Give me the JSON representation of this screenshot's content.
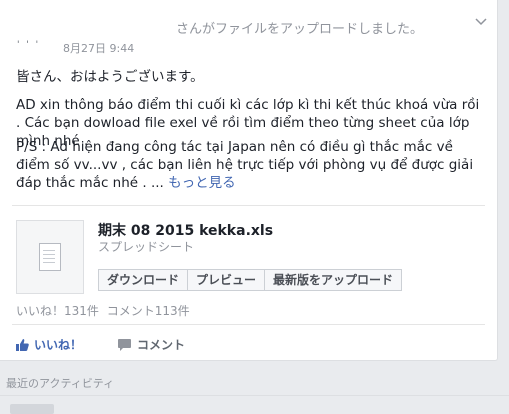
{
  "post": {
    "header": "さんがファイルをアップロードしました。",
    "user_marks": "' ' '",
    "timestamp": "8月27日 9:44",
    "greeting": "皆さん、おはようございます。",
    "paragraph_1": "AD xin thông báo điểm thi cuối kì các lớp kì thi kết thúc khoá vừa rồi . Các bạn dowload file exel về rồi tìm điểm theo từng sheet của lớp mình nhé .",
    "paragraph_2": "P/S : Ad hiện đang công tác tại Japan nên có điều gì thắc mắc về điểm số vv...vv , các bạn liên hệ trực tiếp với phòng vụ để được giải đáp thắc mắc nhé . ...",
    "see_more": "もっと見る"
  },
  "file": {
    "name": "期末 08 2015 kekka.xls",
    "type": "スプレッドシート",
    "buttons": {
      "download": "ダウンロード",
      "preview": "プレビュー",
      "upload_latest": "最新版をアップロード"
    }
  },
  "stats": {
    "likes": "いいね！131件",
    "comments": "コメント113件"
  },
  "actions": {
    "like": "いいね！",
    "comment": "コメント"
  },
  "recent_activity": "最近のアクティビティ",
  "colors": {
    "link_blue": "#4267b2",
    "meta_gray": "#90949c",
    "background": "#e9ebee"
  },
  "icons": [
    "chevron-down-icon",
    "spreadsheet-file-icon",
    "thumbs-up-icon",
    "comment-bubble-icon"
  ]
}
